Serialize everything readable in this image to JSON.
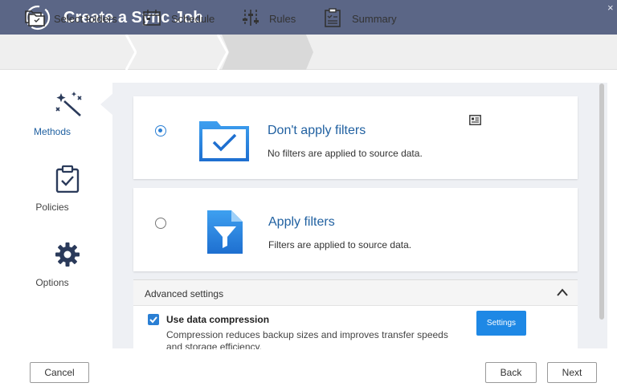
{
  "window": {
    "title": "Create a Sync Job",
    "close_glyph": "×",
    "accent_color": "#5b6686"
  },
  "steps": [
    {
      "label": "Select folders",
      "icon": "folders-icon",
      "active": false
    },
    {
      "label": "Schedule",
      "icon": "calendar-icon",
      "active": false
    },
    {
      "label": "Rules",
      "icon": "sliders-icon",
      "active": true
    },
    {
      "label": "Summary",
      "icon": "clipboard-icon",
      "active": false
    }
  ],
  "nav": [
    {
      "label": "Methods",
      "icon": "magic-wand-icon",
      "active": true
    },
    {
      "label": "Policies",
      "icon": "clipboard-check-icon",
      "active": false
    },
    {
      "label": "Options",
      "icon": "gear-icon",
      "active": false
    }
  ],
  "filters": {
    "options": [
      {
        "title": "Don't apply filters",
        "description": "No filters are applied to source data.",
        "selected": true,
        "icon": "folder-check-icon"
      },
      {
        "title": "Apply filters",
        "description": "Filters are applied to source data.",
        "selected": false,
        "icon": "file-filter-icon"
      }
    ]
  },
  "advanced": {
    "title": "Advanced settings",
    "compression": {
      "label": "Use data compression",
      "description": "Compression reduces backup sizes and improves transfer speeds and storage efficiency.",
      "checked": true
    },
    "settings_label": "Settings"
  },
  "footer": {
    "cancel_label": "Cancel",
    "back_label": "Back",
    "next_label": "Next"
  }
}
